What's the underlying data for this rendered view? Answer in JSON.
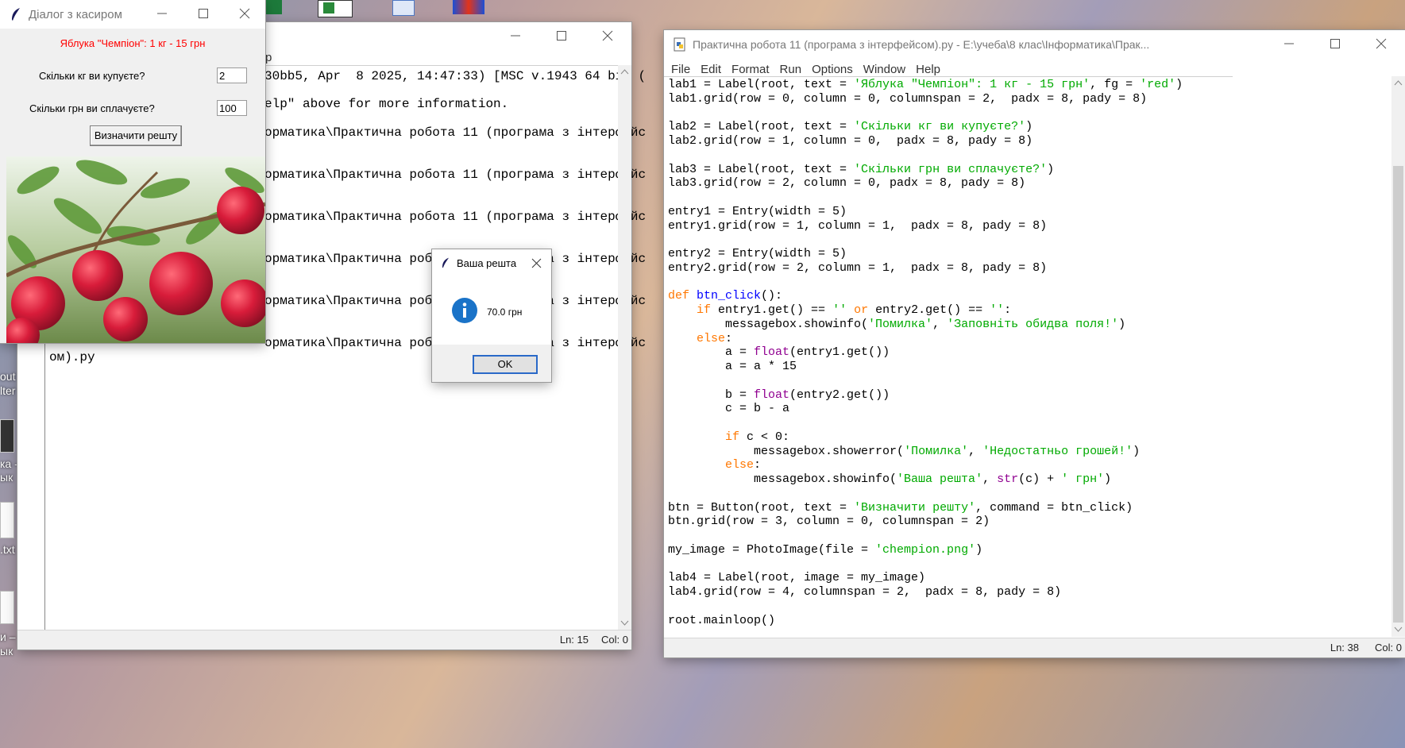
{
  "desktop": {
    "labels": [
      "out",
      "lter",
      "ка -",
      "ык",
      ".txt",
      "и –",
      "ык"
    ]
  },
  "dialog": {
    "title": "Діалог з касиром",
    "heading": "Яблука \"Чемпіон\": 1 кг - 15 грн",
    "kg_label": "Скільки кг ви купуєте?",
    "kg_value": "2",
    "uah_label": "Скільки грн ви сплачуєте?",
    "uah_value": "100",
    "button_label": "Визначити решту"
  },
  "shell": {
    "menu_fragment": "p",
    "lines": [
      "30bb5, Apr  8 2025, 14:47:33) [MSC v.1943 64 bit (",
      "elp\" above for more information.",
      "орматика\\Практична робота 11 (програма з інтерфейс",
      "орматика\\Практична робота 11 (програма з інтерфейс",
      "орматика\\Практична робота 11 (програма з інтерфейс",
      "орматика\\Практична робота 11 (програма з інтерфейс",
      "орматика\\Практична робота 11 (програма з інтерфейс",
      "орматика\\Практична робота 11 (програма з інтерфейс",
      "ом).py"
    ],
    "status": {
      "ln": "Ln: 15",
      "col": "Col: 0"
    }
  },
  "messagebox": {
    "title": "Ваша решта",
    "message": "70.0 грн",
    "ok_label": "OK"
  },
  "editor": {
    "title": "Практична робота 11 (програма з інтерфейсом).py - E:\\учеба\\8 клас\\Інформатика\\Прак...",
    "menu": [
      "File",
      "Edit",
      "Format",
      "Run",
      "Options",
      "Window",
      "Help"
    ],
    "code": [
      [
        [
          "lab1 = Label(root, text = ",
          ""
        ],
        [
          "'Яблука \"Чемпіон\": 1 кг - 15 грн'",
          "st"
        ],
        [
          ", fg = ",
          ""
        ],
        [
          "'red'",
          "st"
        ],
        [
          ")",
          ""
        ]
      ],
      [
        [
          "lab1.grid(row = 0, column = 0, columnspan = 2,  padx = 8, pady = 8)",
          ""
        ]
      ],
      [],
      [
        [
          "lab2 = Label(root, text = ",
          ""
        ],
        [
          "'Скільки кг ви купуєте?'",
          "st"
        ],
        [
          ")",
          ""
        ]
      ],
      [
        [
          "lab2.grid(row = 1, column = 0,  padx = 8, pady = 8)",
          ""
        ]
      ],
      [],
      [
        [
          "lab3 = Label(root, text = ",
          ""
        ],
        [
          "'Скільки грн ви сплачуєте?'",
          "st"
        ],
        [
          ")",
          ""
        ]
      ],
      [
        [
          "lab3.grid(row = 2, column = 0, padx = 8, pady = 8)",
          ""
        ]
      ],
      [],
      [
        [
          "entry1 = Entry(width = 5)",
          ""
        ]
      ],
      [
        [
          "entry1.grid(row = 1, column = 1,  padx = 8, pady = 8)",
          ""
        ]
      ],
      [],
      [
        [
          "entry2 = Entry(width = 5)",
          ""
        ]
      ],
      [
        [
          "entry2.grid(row = 2, column = 1,  padx = 8, pady = 8)",
          ""
        ]
      ],
      [],
      [
        [
          "def ",
          "kw"
        ],
        [
          "btn_click",
          "fn"
        ],
        [
          "():",
          ""
        ]
      ],
      [
        [
          "    ",
          ""
        ],
        [
          "if ",
          "kw"
        ],
        [
          "entry1.get() == ",
          ""
        ],
        [
          "''",
          "st"
        ],
        [
          " or ",
          "kw"
        ],
        [
          "entry2.get() == ",
          ""
        ],
        [
          "''",
          "st"
        ],
        [
          ":",
          ""
        ]
      ],
      [
        [
          "        messagebox.showinfo(",
          ""
        ],
        [
          "'Помилка'",
          "st"
        ],
        [
          ", ",
          ""
        ],
        [
          "'Заповніть обидва поля!'",
          "st"
        ],
        [
          ")",
          ""
        ]
      ],
      [
        [
          "    ",
          ""
        ],
        [
          "else",
          "kw"
        ],
        [
          ":",
          ""
        ]
      ],
      [
        [
          "        a = ",
          ""
        ],
        [
          "float",
          "bi"
        ],
        [
          "(entry1.get())",
          ""
        ]
      ],
      [
        [
          "        a = a * 15",
          ""
        ]
      ],
      [],
      [
        [
          "        b = ",
          ""
        ],
        [
          "float",
          "bi"
        ],
        [
          "(entry2.get())",
          ""
        ]
      ],
      [
        [
          "        c = b - a",
          ""
        ]
      ],
      [],
      [
        [
          "        ",
          ""
        ],
        [
          "if ",
          "kw"
        ],
        [
          "c < 0:",
          ""
        ]
      ],
      [
        [
          "            messagebox.showerror(",
          ""
        ],
        [
          "'Помилка'",
          "st"
        ],
        [
          ", ",
          ""
        ],
        [
          "'Недостатньо грошей!'",
          "st"
        ],
        [
          ")",
          ""
        ]
      ],
      [
        [
          "        ",
          ""
        ],
        [
          "else",
          "kw"
        ],
        [
          ":",
          ""
        ]
      ],
      [
        [
          "            messagebox.showinfo(",
          ""
        ],
        [
          "'Ваша решта'",
          "st"
        ],
        [
          ", ",
          ""
        ],
        [
          "str",
          "bi"
        ],
        [
          "(c) + ",
          ""
        ],
        [
          "' грн'",
          "st"
        ],
        [
          ")",
          ""
        ]
      ],
      [],
      [
        [
          "btn = Button(root, text = ",
          ""
        ],
        [
          "'Визначити решту'",
          "st"
        ],
        [
          ", command = btn_click)",
          ""
        ]
      ],
      [
        [
          "btn.grid(row = 3, column = 0, columnspan = 2)",
          ""
        ]
      ],
      [],
      [
        [
          "my_image = PhotoImage(file = ",
          ""
        ],
        [
          "'chempion.png'",
          "st"
        ],
        [
          ")",
          ""
        ]
      ],
      [],
      [
        [
          "lab4 = Label(root, image = my_image)",
          ""
        ]
      ],
      [
        [
          "lab4.grid(row = 4, columnspan = 2,  padx = 8, pady = 8)",
          ""
        ]
      ],
      [],
      [
        [
          "root.mainloop()",
          ""
        ]
      ]
    ],
    "status": {
      "ln": "Ln: 38",
      "col": "Col: 0"
    }
  },
  "colors": {
    "keyword": "#ff7700",
    "builtin": "#900090",
    "string": "#00aa00",
    "definition": "#0000ff",
    "heading_red": "#ff0000",
    "info_blue": "#1a73c8"
  }
}
